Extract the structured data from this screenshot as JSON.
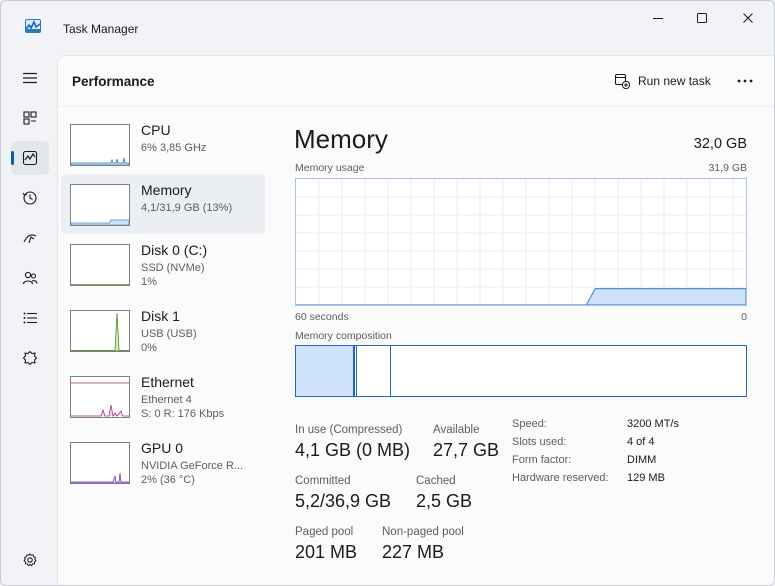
{
  "window": {
    "title": "Task Manager"
  },
  "nav": {
    "items": [
      {
        "icon": "hamburger-menu-icon"
      },
      {
        "icon": "processes-icon"
      },
      {
        "icon": "performance-icon",
        "active": true
      },
      {
        "icon": "app-history-icon"
      },
      {
        "icon": "startup-apps-icon"
      },
      {
        "icon": "users-icon"
      },
      {
        "icon": "details-icon"
      },
      {
        "icon": "services-icon"
      }
    ],
    "settings_icon": "gear-icon"
  },
  "header": {
    "title": "Performance",
    "run_new_task": "Run new task",
    "more_icon": "more-options-icon"
  },
  "devices": [
    {
      "name": "CPU",
      "lines": [
        "6% 3,85 GHz"
      ],
      "accent": "#2b7bb9"
    },
    {
      "name": "Memory",
      "lines": [
        "4,1/31,9 GB (13%)"
      ],
      "accent": "#2b7bb9",
      "selected": true
    },
    {
      "name": "Disk 0 (C:)",
      "lines": [
        "SSD (NVMe)",
        "1%"
      ],
      "accent": "#4d8a1f"
    },
    {
      "name": "Disk 1",
      "lines": [
        "USB (USB)",
        "0%"
      ],
      "accent": "#4d8a1f"
    },
    {
      "name": "Ethernet",
      "lines": [
        "Ethernet 4",
        "S: 0 R: 176 Kbps"
      ],
      "accent": "#a6337f"
    },
    {
      "name": "GPU 0",
      "lines": [
        "NVIDIA GeForce R...",
        "2% (36 °C)"
      ],
      "accent": "#7b3fb6"
    }
  ],
  "memory": {
    "title": "Memory",
    "total": "32,0 GB",
    "usage_label": "Memory usage",
    "usage_max": "31,9 GB",
    "time_left": "60 seconds",
    "time_right": "0",
    "usage_fraction": 0.13,
    "composition_label": "Memory composition",
    "composition": {
      "in_use_fraction": 0.13,
      "modified_fraction": 0.005,
      "standby_fraction": 0.075
    },
    "stats": {
      "in_use_label": "In use (Compressed)",
      "in_use_value": "4,1 GB (0 MB)",
      "available_label": "Available",
      "available_value": "27,7 GB",
      "committed_label": "Committed",
      "committed_value": "5,2/36,9 GB",
      "cached_label": "Cached",
      "cached_value": "2,5 GB",
      "paged_label": "Paged pool",
      "paged_value": "201 MB",
      "nonpaged_label": "Non-paged pool",
      "nonpaged_value": "227 MB"
    },
    "specs": [
      {
        "label": "Speed:",
        "value": "3200 MT/s"
      },
      {
        "label": "Slots used:",
        "value": "4 of 4"
      },
      {
        "label": "Form factor:",
        "value": "DIMM"
      },
      {
        "label": "Hardware reserved:",
        "value": "129 MB"
      }
    ]
  },
  "colors": {
    "accent": "#005fb8",
    "memory_fill": "#cfe2fb",
    "memory_line": "#4a8fd6",
    "composition_border": "#1f66c0"
  }
}
